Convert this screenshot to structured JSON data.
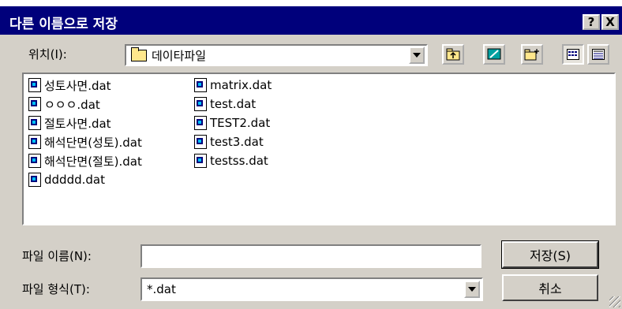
{
  "window": {
    "title": "다른 이름으로 저장",
    "help_button": "?",
    "close_button": "X"
  },
  "location": {
    "label": "위치(I):",
    "value": "데이타파일"
  },
  "files": [
    [
      "성토사면.dat",
      "ㅇㅇㅇ.dat",
      "절토사면.dat",
      "해석단면(성토).dat",
      "해석단면(절토).dat",
      "ddddd.dat"
    ],
    [
      "matrix.dat",
      "test.dat",
      "TEST2.dat",
      "test3.dat",
      "testss.dat"
    ]
  ],
  "filename": {
    "label": "파일 이름(N):",
    "value": ""
  },
  "filetype": {
    "label": "파일 형식(T):",
    "value": "*.dat"
  },
  "buttons": {
    "save": "저장(S)",
    "cancel": "취소"
  },
  "colors": {
    "titlebar": "#00007b",
    "face": "#d4d0c8"
  }
}
